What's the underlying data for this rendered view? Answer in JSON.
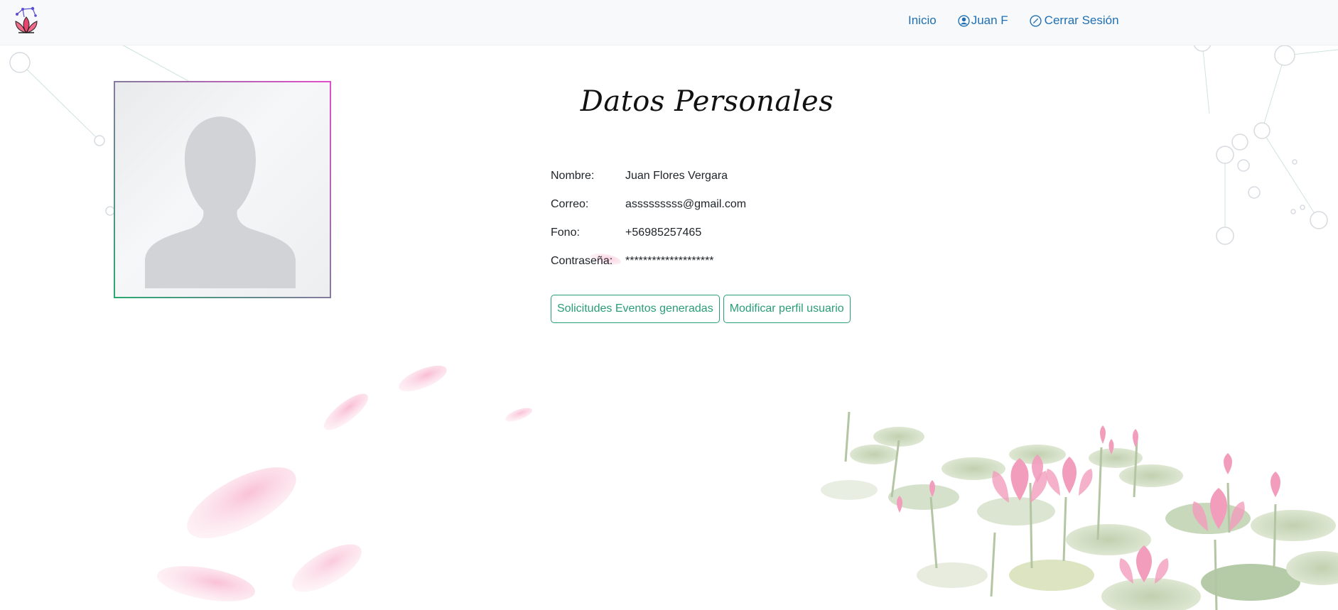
{
  "navbar": {
    "logo_alt": "lotus-logo",
    "items": [
      {
        "label": "Inicio",
        "icon": ""
      },
      {
        "label": "Juan F",
        "icon": "user-circle-icon"
      },
      {
        "label": "Cerrar Sesión",
        "icon": "slash-circle-icon"
      }
    ]
  },
  "profile": {
    "title": "Datos Personales",
    "fields": [
      {
        "label": "Nombre:",
        "value": "Juan Flores Vergara"
      },
      {
        "label": "Correo:",
        "value": "asssssssss@gmail.com"
      },
      {
        "label": "Fono:",
        "value": "+56985257465"
      },
      {
        "label": "Contraseña:",
        "value": "********************"
      }
    ],
    "buttons": {
      "requests": "Solicitudes Eventos generadas",
      "edit": "Modificar perfil usuario"
    }
  },
  "colors": {
    "link": "#1f6fb2",
    "button": "#2a9d78",
    "frame_gradient": [
      "#2aa871",
      "#e04ec9"
    ]
  }
}
